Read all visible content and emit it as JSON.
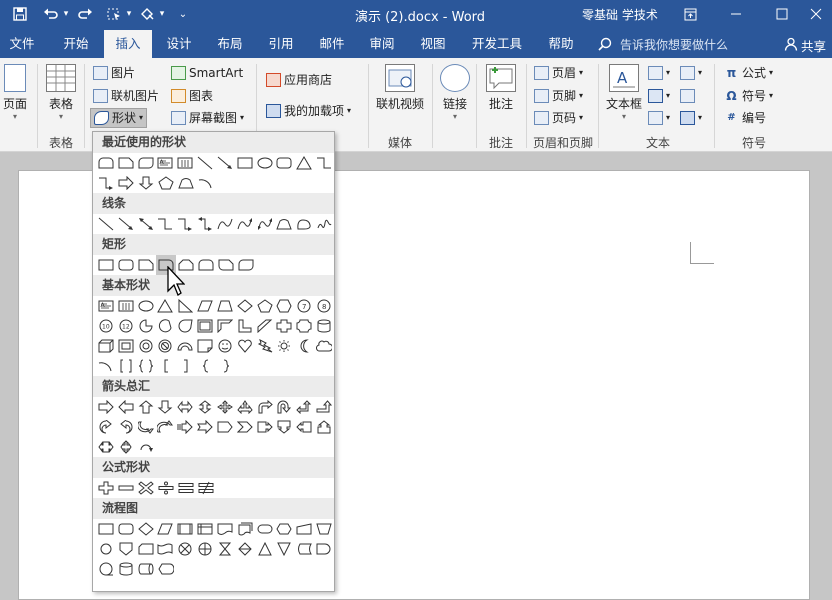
{
  "titlebar": {
    "title": "演示 (2).docx - Word",
    "user": "零基础 学技术",
    "qat": [
      {
        "name": "save-icon",
        "glyph": "🖫"
      },
      {
        "name": "undo-icon",
        "glyph": "↶"
      },
      {
        "name": "redo-icon",
        "glyph": "↷"
      }
    ]
  },
  "tabs": [
    "文件",
    "开始",
    "插入",
    "设计",
    "布局",
    "引用",
    "邮件",
    "审阅",
    "视图",
    "开发工具",
    "帮助"
  ],
  "active_tab": "插入",
  "tell_me": "告诉我你想要做什么",
  "share": "共享",
  "ribbon": {
    "page": "页面",
    "table": "表格",
    "table_group": "表格",
    "pictures": "图片",
    "online_pictures": "联机图片",
    "shapes": "形状",
    "smartart": "SmartArt",
    "chart": "图表",
    "screenshot": "屏幕截图",
    "store": "应用商店",
    "my_addins": "我的加载项",
    "online_video": "联机视频",
    "media_group": "媒体",
    "link": "链接",
    "comment": "批注",
    "comment_group": "批注",
    "header": "页眉",
    "footer": "页脚",
    "page_number": "页码",
    "hf_group": "页眉和页脚",
    "textbox": "文本框",
    "text_group": "文本",
    "equation": "公式",
    "symbol": "符号",
    "numbering": "编号",
    "symbols_group": "符号"
  },
  "shapes_panel": {
    "categories": [
      {
        "label": "最近使用的形状",
        "shapes": [
          "rounded-tab",
          "rect-snip",
          "round-diag",
          "text-box",
          "vert-text-box",
          "line",
          "arrow-line",
          "rect",
          "ellipse",
          "round-rect",
          "triangle",
          "elbow",
          "elbow-arrow",
          "right-arrow",
          "down-arrow",
          "pentagon",
          "freeform",
          "arc"
        ]
      },
      {
        "label": "线条",
        "shapes": [
          "line",
          "arrow-line",
          "double-arrow-line",
          "elbow",
          "elbow-arrow",
          "elbow-double-arrow",
          "curve",
          "curve-arrow",
          "curve-double-arrow",
          "freeform",
          "scribble-shape",
          "scribble"
        ]
      },
      {
        "label": "矩形",
        "shapes": [
          "rect",
          "round-rect",
          "snip-one",
          "round-one",
          "snip-two",
          "round-two",
          "snip-round",
          "round-diag"
        ]
      },
      {
        "label": "基本形状",
        "shapes": [
          "text-box",
          "vert-text-box",
          "ellipse",
          "triangle",
          "right-triangle",
          "parallelogram",
          "trapezoid",
          "diamond",
          "pentagon",
          "hexagon",
          "heptagon",
          "octagon",
          "decagon",
          "dodecagon",
          "pie",
          "chord",
          "teardrop",
          "frame",
          "half-frame",
          "l-shape",
          "diagonal-stripe",
          "cross",
          "plaque",
          "can",
          "cube",
          "bevel",
          "donut",
          "no-symbol",
          "block-arc",
          "folded-corner",
          "smiley",
          "heart",
          "lightning",
          "sun",
          "moon",
          "cloud",
          "arc",
          "double-bracket",
          "double-brace",
          "left-bracket",
          "right-bracket",
          "left-brace",
          "right-brace"
        ]
      },
      {
        "label": "箭头总汇",
        "shapes": [
          "right-arrow",
          "left-arrow",
          "up-arrow",
          "down-arrow",
          "left-right-arrow",
          "up-down-arrow",
          "quad-arrow",
          "left-right-up-arrow",
          "bent-arrow",
          "u-turn-arrow",
          "left-up-arrow",
          "bent-up-arrow",
          "curved-right-arrow",
          "curved-left-arrow",
          "curved-up-arrow",
          "curved-down-arrow",
          "striped-arrow",
          "notched-arrow",
          "pentagon-arrow",
          "chevron",
          "right-callout",
          "down-callout",
          "left-callout",
          "up-callout",
          "left-right-callout",
          "quad-callout",
          "circular-arrow"
        ]
      },
      {
        "label": "公式形状",
        "shapes": [
          "plus",
          "minus",
          "multiply",
          "divide",
          "equal",
          "not-equal"
        ]
      },
      {
        "label": "流程图",
        "shapes": [
          "process",
          "alt-process",
          "decision",
          "data",
          "predefined",
          "internal-storage",
          "document",
          "multidocument",
          "terminator",
          "preparation",
          "manual-input",
          "manual-operation",
          "connector",
          "offpage",
          "card",
          "punched-tape",
          "summing",
          "or",
          "collate",
          "sort",
          "extract",
          "merge",
          "stored-data",
          "delay",
          "sequential-access",
          "magnetic-disk",
          "direct-access",
          "display"
        ]
      }
    ]
  }
}
